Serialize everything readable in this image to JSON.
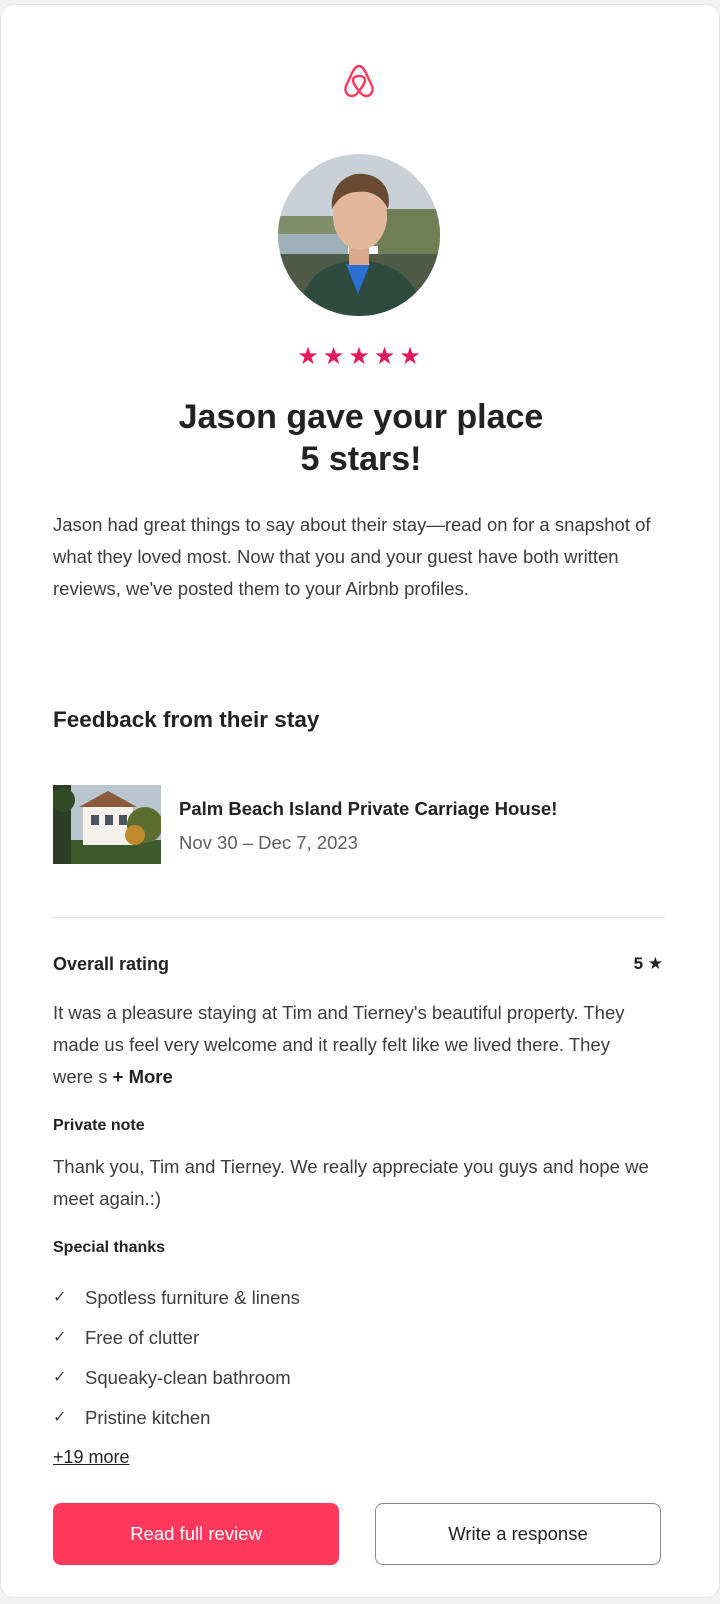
{
  "brand": {
    "logo_icon": "airbnb-logo-icon",
    "accent": "#ff385c",
    "star_color": "#e5195a"
  },
  "review": {
    "stars_display": "★★★★★",
    "star_count": 5,
    "title_line1": "Jason gave your place",
    "title_line2": "5 stars!",
    "intro": "Jason had great things to say about their stay—read on for a snapshot of what they loved most. Now that you and your guest have both written reviews, we've posted them to your Airbnb profiles."
  },
  "feedback": {
    "section_title": "Feedback from their stay",
    "listing": {
      "name": "Palm Beach Island Private Carriage House!",
      "dates": "Nov 30 – Dec 7, 2023"
    },
    "overall": {
      "label": "Overall rating",
      "value": "5 ★",
      "text": "It was a pleasure staying at Tim and Tierney's beautiful property. They made us feel very welcome and it really felt like we lived there. They were s",
      "more_label": "+ More"
    },
    "private_note": {
      "label": "Private note",
      "text": "Thank you, Tim and Tierney. We really appreciate you guys and hope we meet again.:)"
    },
    "special_thanks": {
      "label": "Special thanks",
      "items": [
        "Spotless furniture & linens",
        "Free of clutter",
        "Squeaky-clean bathroom",
        "Pristine kitchen"
      ],
      "more_label": "+19 more"
    }
  },
  "actions": {
    "read_full_review": "Read full review",
    "write_response": "Write a response"
  }
}
